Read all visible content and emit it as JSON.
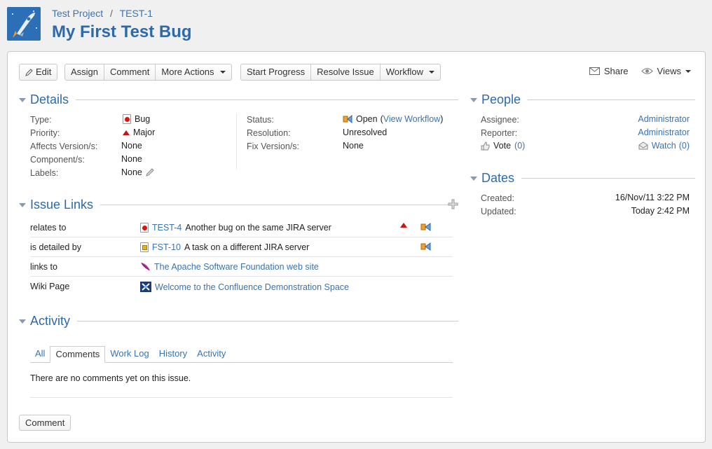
{
  "breadcrumb": {
    "project": "Test Project",
    "separator": "/",
    "issue_key": "TEST-1"
  },
  "title": "My First Test Bug",
  "toolbar": {
    "edit": "Edit",
    "assign": "Assign",
    "comment": "Comment",
    "more_actions": "More Actions",
    "start_progress": "Start Progress",
    "resolve_issue": "Resolve Issue",
    "workflow": "Workflow",
    "share": "Share",
    "views": "Views"
  },
  "details": {
    "heading": "Details",
    "type_label": "Type:",
    "type_value": "Bug",
    "priority_label": "Priority:",
    "priority_value": "Major",
    "affects_label": "Affects Version/s:",
    "affects_value": "None",
    "component_label": "Component/s:",
    "component_value": "None",
    "labels_label": "Labels:",
    "labels_value": "None",
    "status_label": "Status:",
    "status_value": "Open",
    "status_paren_open": "(",
    "view_workflow": "View Workflow",
    "status_paren_close": ")",
    "resolution_label": "Resolution:",
    "resolution_value": "Unresolved",
    "fix_label": "Fix Version/s:",
    "fix_value": "None"
  },
  "people": {
    "heading": "People",
    "assignee_label": "Assignee:",
    "assignee_value": "Administrator",
    "reporter_label": "Reporter:",
    "reporter_value": "Administrator",
    "vote_label": "Vote",
    "vote_count": "(0)",
    "watch_label": "Watch",
    "watch_count": "(0)"
  },
  "dates": {
    "heading": "Dates",
    "created_label": "Created:",
    "created_value": "16/Nov/11 3:22 PM",
    "updated_label": "Updated:",
    "updated_value": "Today 2:42 PM"
  },
  "issue_links": {
    "heading": "Issue Links",
    "rows": [
      {
        "relation": "relates to",
        "key": "TEST-4",
        "summary": "Another bug on the same JIRA server"
      },
      {
        "relation": "is detailed by",
        "key": "FST-10",
        "summary": "A task on a different JIRA server"
      },
      {
        "relation": "links to",
        "key": "",
        "summary": "The Apache Software Foundation web site"
      },
      {
        "relation": "Wiki Page",
        "key": "",
        "summary": "Welcome to the Confluence Demonstration Space"
      }
    ]
  },
  "activity": {
    "heading": "Activity",
    "tabs": [
      "All",
      "Comments",
      "Work Log",
      "History",
      "Activity"
    ],
    "active_tab": "Comments",
    "empty_message": "There are no comments yet on this issue.",
    "comment_button": "Comment"
  },
  "colors": {
    "link": "#3b73af",
    "title": "#2f6aa8",
    "priority_major": "#cc1111"
  }
}
